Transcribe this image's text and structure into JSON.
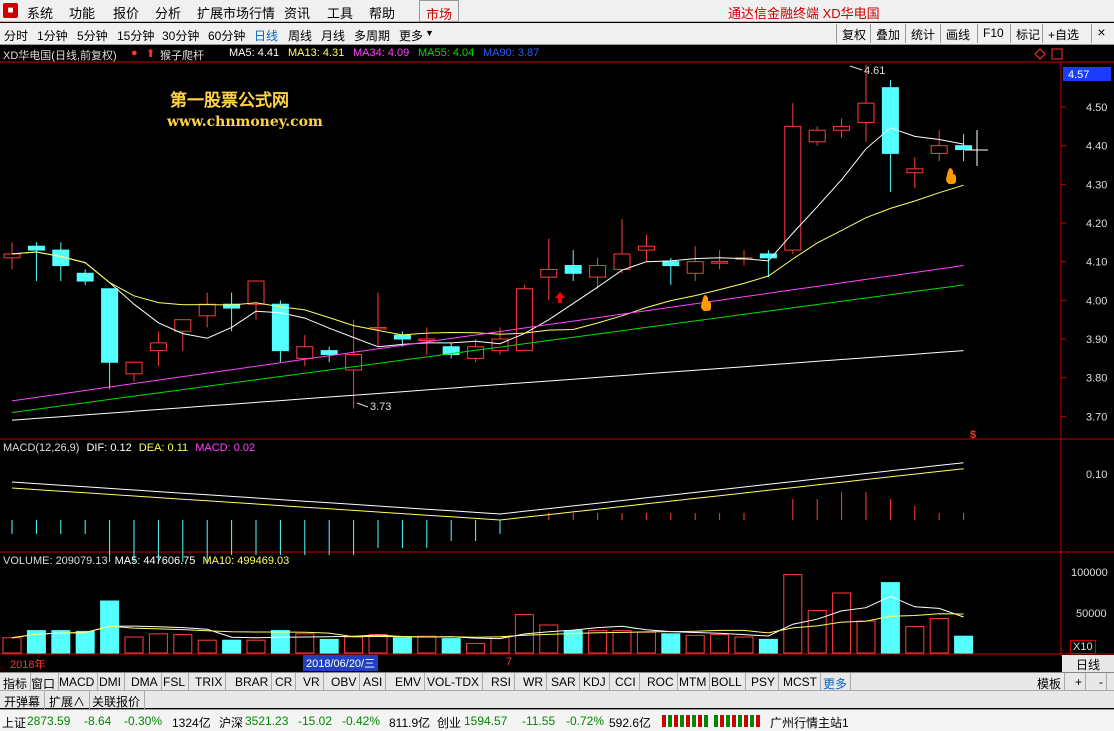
{
  "menu": {
    "items": [
      "系统",
      "功能",
      "报价",
      "分析",
      "扩展市场行情",
      "资讯",
      "工具",
      "帮助"
    ],
    "market_btn": "市场",
    "brand": "通达信金融终端 XD华电国"
  },
  "toolbar": {
    "periods": [
      "分时",
      "1分钟",
      "5分钟",
      "15分钟",
      "30分钟",
      "60分钟",
      "日线",
      "周线",
      "月线",
      "多周期",
      "更多"
    ],
    "active": "日线",
    "right_buttons": [
      "复权",
      "叠加",
      "统计",
      "画线",
      "F10",
      "标记",
      "+自选"
    ],
    "close": "×"
  },
  "title_line": {
    "stock": "XD华电国(日线,前复权)",
    "formula": "猴子爬杆",
    "ma5": "MA5: 4.41",
    "ma13": "MA13: 4.31",
    "ma34": "MA34: 4.09",
    "ma55": "MA55: 4.04",
    "ma90": "MA90: 3.87"
  },
  "watermark": {
    "line1": "第一股票公式网",
    "line2": "www.chnmoney.com"
  },
  "price_axis": {
    "current": "4.57",
    "ticks": [
      "4.50",
      "4.40",
      "4.30",
      "4.20",
      "4.10",
      "4.00",
      "3.90",
      "3.80",
      "3.70"
    ]
  },
  "annotations": {
    "high": "4.61",
    "low": "3.73"
  },
  "macd": {
    "title": "MACD(12,26,9)",
    "dif": "DIF: 0.12",
    "dea": "DEA: 0.11",
    "macd": "MACD: 0.02",
    "tick": "0.10"
  },
  "volume": {
    "title": "VOLUME: 209079.13",
    "ma5": "MA5: 447606.75",
    "ma10": "MA10: 499469.03",
    "ticks": [
      "100000",
      "50000"
    ],
    "unit": "X10"
  },
  "date_axis": {
    "year": "2018年",
    "cursor": "2018/06/20/三",
    "month": "7",
    "right": "日线"
  },
  "tabs": [
    "指标",
    "窗口",
    "MACD",
    "DMI",
    "DMA",
    "FSL",
    "TRIX",
    "BRAR",
    "CR",
    "VR",
    "OBV",
    "ASI",
    "EMV",
    "VOL-TDX",
    "RSI",
    "WR",
    "SAR",
    "KDJ",
    "CCI",
    "ROC",
    "MTM",
    "BOLL",
    "PSY",
    "MCST",
    "更多"
  ],
  "tab_right": {
    "template": "模板",
    "plus": "+",
    "minus": "-"
  },
  "subtabs": [
    "开弹幕",
    "扩展∧",
    "关联报价"
  ],
  "status": {
    "sh_label": "上证",
    "sh_val": "2873.59",
    "sh_chg": "-8.64",
    "sh_pct": "-0.30%",
    "sh_amt": "1324亿",
    "sz_label": "沪深",
    "sz_val": "3521.23",
    "sz_chg": "-15.02",
    "sz_pct": "-0.42%",
    "sz_amt": "811.9亿",
    "cy_label": "创业",
    "cy_val": "1594.57",
    "cy_chg": "-11.55",
    "cy_pct": "-0.72%",
    "cy_amt": "592.6亿",
    "server": "广州行情主站1"
  },
  "colors": {
    "up": "#ff3c3c",
    "down": "#54ffff",
    "ma5": "#ffffff",
    "ma13": "#ffff60",
    "ma34": "#ff44ff",
    "ma55": "#00dd00",
    "ma90": "#ffffff"
  },
  "chart_data": {
    "type": "candlestick",
    "candles": [
      {
        "o": 4.11,
        "c": 4.12,
        "h": 4.15,
        "l": 4.08
      },
      {
        "o": 4.14,
        "c": 4.13,
        "h": 4.15,
        "l": 4.05
      },
      {
        "o": 4.13,
        "c": 4.09,
        "h": 4.15,
        "l": 4.05
      },
      {
        "o": 4.07,
        "c": 4.05,
        "h": 4.08,
        "l": 4.04
      },
      {
        "o": 4.03,
        "c": 3.84,
        "h": 4.03,
        "l": 3.77
      },
      {
        "o": 3.81,
        "c": 3.84,
        "h": 3.84,
        "l": 3.79
      },
      {
        "o": 3.87,
        "c": 3.89,
        "h": 3.92,
        "l": 3.83
      },
      {
        "o": 3.92,
        "c": 3.95,
        "h": 3.95,
        "l": 3.87
      },
      {
        "o": 3.96,
        "c": 3.99,
        "h": 4.02,
        "l": 3.93
      },
      {
        "o": 3.99,
        "c": 3.98,
        "h": 4.02,
        "l": 3.92
      },
      {
        "o": 3.99,
        "c": 4.05,
        "h": 4.05,
        "l": 3.95
      },
      {
        "o": 3.99,
        "c": 3.87,
        "h": 4.0,
        "l": 3.84
      },
      {
        "o": 3.85,
        "c": 3.88,
        "h": 3.91,
        "l": 3.83
      },
      {
        "o": 3.87,
        "c": 3.86,
        "h": 3.88,
        "l": 3.84
      },
      {
        "o": 3.82,
        "c": 3.86,
        "h": 3.95,
        "l": 3.72
      },
      {
        "o": 3.93,
        "c": 3.93,
        "h": 4.02,
        "l": 3.88
      },
      {
        "o": 3.91,
        "c": 3.9,
        "h": 3.92,
        "l": 3.88
      },
      {
        "o": 3.9,
        "c": 3.9,
        "h": 3.93,
        "l": 3.86
      },
      {
        "o": 3.88,
        "c": 3.86,
        "h": 3.89,
        "l": 3.85
      },
      {
        "o": 3.85,
        "c": 3.88,
        "h": 3.9,
        "l": 3.84
      },
      {
        "o": 3.87,
        "c": 3.9,
        "h": 3.93,
        "l": 3.86
      },
      {
        "o": 3.87,
        "c": 4.03,
        "h": 4.04,
        "l": 3.87
      },
      {
        "o": 4.06,
        "c": 4.08,
        "h": 4.16,
        "l": 4.0
      },
      {
        "o": 4.09,
        "c": 4.07,
        "h": 4.13,
        "l": 4.05
      },
      {
        "o": 4.06,
        "c": 4.09,
        "h": 4.11,
        "l": 4.03
      },
      {
        "o": 4.08,
        "c": 4.12,
        "h": 4.21,
        "l": 4.07
      },
      {
        "o": 4.13,
        "c": 4.14,
        "h": 4.17,
        "l": 4.1
      },
      {
        "o": 4.1,
        "c": 4.09,
        "h": 4.11,
        "l": 4.04
      },
      {
        "o": 4.07,
        "c": 4.1,
        "h": 4.14,
        "l": 4.05
      },
      {
        "o": 4.1,
        "c": 4.1,
        "h": 4.13,
        "l": 4.08
      },
      {
        "o": 4.11,
        "c": 4.11,
        "h": 4.13,
        "l": 4.09
      },
      {
        "o": 4.12,
        "c": 4.11,
        "h": 4.13,
        "l": 4.06
      },
      {
        "o": 4.13,
        "c": 4.45,
        "h": 4.51,
        "l": 4.12
      },
      {
        "o": 4.41,
        "c": 4.44,
        "h": 4.45,
        "l": 4.4
      },
      {
        "o": 4.44,
        "c": 4.45,
        "h": 4.47,
        "l": 4.42
      },
      {
        "o": 4.46,
        "c": 4.51,
        "h": 4.61,
        "l": 4.41
      },
      {
        "o": 4.55,
        "c": 4.38,
        "h": 4.57,
        "l": 4.28
      },
      {
        "o": 4.33,
        "c": 4.34,
        "h": 4.37,
        "l": 4.29
      },
      {
        "o": 4.38,
        "c": 4.4,
        "h": 4.44,
        "l": 4.36
      },
      {
        "o": 4.4,
        "c": 4.39,
        "h": 4.43,
        "l": 4.36
      }
    ],
    "volume_x10": [
      19000,
      28000,
      28000,
      27000,
      65000,
      20000,
      24000,
      23000,
      16000,
      16000,
      16000,
      28000,
      24000,
      17000,
      20000,
      23000,
      19000,
      21000,
      18000,
      12000,
      20000,
      48000,
      35000,
      28000,
      28000,
      28000,
      26000,
      24000,
      22000,
      23000,
      20000,
      17000,
      98000,
      53000,
      75000,
      40000,
      88000,
      33000,
      43000,
      21000
    ],
    "macd_hist": [
      -0.02,
      -0.02,
      -0.02,
      -0.02,
      -0.06,
      -0.06,
      -0.06,
      -0.06,
      -0.06,
      -0.05,
      -0.05,
      -0.05,
      -0.05,
      -0.05,
      -0.05,
      -0.04,
      -0.04,
      -0.04,
      -0.03,
      -0.03,
      -0.02,
      0.0,
      0.01,
      0.01,
      0.01,
      0.01,
      0.01,
      0.01,
      0.01,
      0.01,
      0.01,
      0.0,
      0.03,
      0.03,
      0.04,
      0.04,
      0.03,
      0.02,
      0.01,
      0.01
    ]
  }
}
